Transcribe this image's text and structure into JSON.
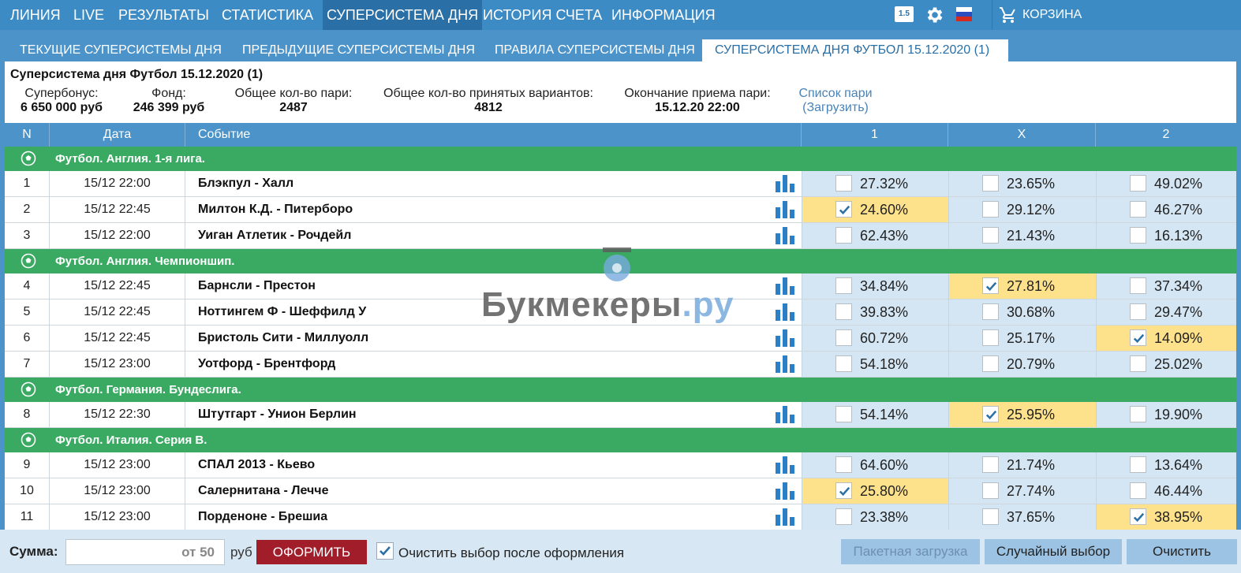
{
  "nav": {
    "items": [
      "ЛИНИЯ",
      "LIVE",
      "РЕЗУЛЬТАТЫ",
      "СТАТИСТИКА",
      "СУПЕРСИСТЕМА ДНЯ",
      "ИСТОРИЯ СЧЕТА",
      "ИНФОРМАЦИЯ"
    ],
    "active_index": 4,
    "version_badge": "1.5",
    "cart_label": "КОРЗИНА",
    "icons": [
      "gear-icon",
      "flag-ru-icon",
      "cart-icon"
    ]
  },
  "subtabs": {
    "items": [
      "ТЕКУЩИЕ СУПЕРСИСТЕМЫ ДНЯ",
      "ПРЕДЫДУЩИЕ СУПЕРСИСТЕМЫ ДНЯ",
      "ПРАВИЛА СУПЕРСИСТЕМЫ ДНЯ",
      "СУПЕРСИСТЕМА ДНЯ ФУТБОЛ 15.12.2020 (1)"
    ],
    "active_index": 3
  },
  "info": {
    "title": "Суперсистема дня Футбол 15.12.2020 (1)",
    "superbonus_label": "Супербонус:",
    "superbonus_value": "6 650 000 руб",
    "fund_label": "Фонд:",
    "fund_value": "246 399 руб",
    "bets_label": "Общее кол-во пари:",
    "bets_value": "2487",
    "variants_label": "Общее кол-во принятых вариантов:",
    "variants_value": "4812",
    "end_label": "Окончание приема пари:",
    "end_value": "15.12.20 22:00",
    "list_link": "Список пари",
    "load_link": "(Загрузить)"
  },
  "table": {
    "headers": {
      "n": "N",
      "date": "Дата",
      "event": "Событие",
      "o1": "1",
      "ox": "X",
      "o2": "2"
    },
    "groups": [
      {
        "name": "Футбол. Англия. 1-я лига.",
        "events": [
          {
            "n": "1",
            "date": "15/12 22:00",
            "event": "Блэкпул - Халл",
            "odds": [
              "27.32%",
              "23.65%",
              "49.02%"
            ],
            "selected": -1
          },
          {
            "n": "2",
            "date": "15/12 22:45",
            "event": "Милтон К.Д. - Питерборо",
            "odds": [
              "24.60%",
              "29.12%",
              "46.27%"
            ],
            "selected": 0
          },
          {
            "n": "3",
            "date": "15/12 22:00",
            "event": "Уиган Атлетик - Рочдейл",
            "odds": [
              "62.43%",
              "21.43%",
              "16.13%"
            ],
            "selected": -1
          }
        ]
      },
      {
        "name": "Футбол. Англия. Чемпионшип.",
        "events": [
          {
            "n": "4",
            "date": "15/12 22:45",
            "event": "Барнсли - Престон",
            "odds": [
              "34.84%",
              "27.81%",
              "37.34%"
            ],
            "selected": 1
          },
          {
            "n": "5",
            "date": "15/12 22:45",
            "event": "Ноттингем Ф - Шеффилд У",
            "odds": [
              "39.83%",
              "30.68%",
              "29.47%"
            ],
            "selected": -1
          },
          {
            "n": "6",
            "date": "15/12 22:45",
            "event": "Бристоль Сити - Миллуолл",
            "odds": [
              "60.72%",
              "25.17%",
              "14.09%"
            ],
            "selected": 2
          },
          {
            "n": "7",
            "date": "15/12 23:00",
            "event": "Уотфорд - Брентфорд",
            "odds": [
              "54.18%",
              "20.79%",
              "25.02%"
            ],
            "selected": -1
          }
        ]
      },
      {
        "name": "Футбол. Германия. Бундеслига.",
        "events": [
          {
            "n": "8",
            "date": "15/12 22:30",
            "event": "Штутгарт - Унион Берлин",
            "odds": [
              "54.14%",
              "25.95%",
              "19.90%"
            ],
            "selected": 1
          }
        ]
      },
      {
        "name": "Футбол. Италия. Серия B.",
        "events": [
          {
            "n": "9",
            "date": "15/12 23:00",
            "event": "СПАЛ 2013 - Кьево",
            "odds": [
              "64.60%",
              "21.74%",
              "13.64%"
            ],
            "selected": -1
          },
          {
            "n": "10",
            "date": "15/12 23:00",
            "event": "Салернитана - Лечче",
            "odds": [
              "25.80%",
              "27.74%",
              "46.44%"
            ],
            "selected": 0
          },
          {
            "n": "11",
            "date": "15/12 23:00",
            "event": "Порденоне - Брешиа",
            "odds": [
              "23.38%",
              "37.65%",
              "38.95%"
            ],
            "selected": 2
          }
        ]
      }
    ]
  },
  "watermark": {
    "main": "Букмекеры",
    "suffix": ".ру"
  },
  "footer": {
    "sum_label": "Сумма:",
    "amount_placeholder": "от 50",
    "currency": "руб",
    "submit_label": "ОФОРМИТЬ",
    "clear_after_label": "Очистить выбор после оформления",
    "clear_after_checked": true,
    "batch_label": "Пакетная загрузка",
    "random_label": "Случайный выбор",
    "clear_label": "Очистить"
  },
  "colors": {
    "nav": "#3d8bc5",
    "group": "#3aaa63",
    "odds_bg": "#d4e6f3",
    "selected": "#fde18b",
    "submit": "#a21d2a"
  }
}
